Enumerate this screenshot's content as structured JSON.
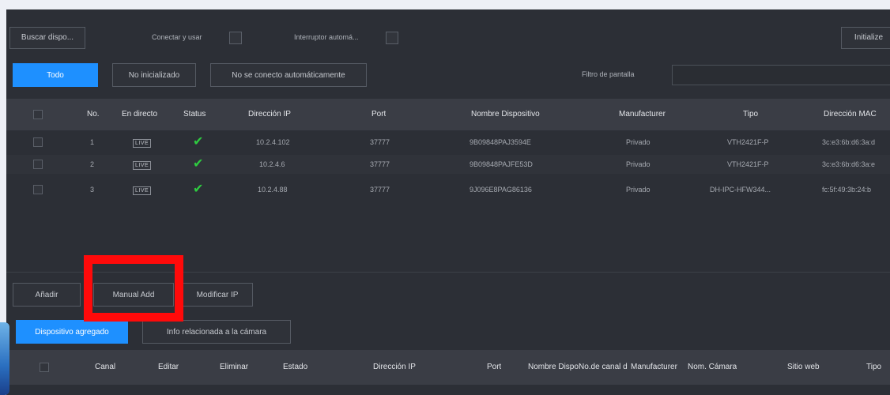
{
  "toolbar": {
    "search_label": "Buscar dispo...",
    "plug_label": "Conectar y usar",
    "auto_switch_label": "Interruptor automá...",
    "init_label": "Initialize"
  },
  "filters": {
    "tabs": [
      "Todo",
      "No inicializado",
      "No se conecto automáticamente"
    ],
    "screen_filter_label": "Filtro de pantalla",
    "screen_filter_value": ""
  },
  "devices_table": {
    "headers": [
      "No.",
      "En directo",
      "Status",
      "Dirección IP",
      "Port",
      "Nombre Dispositivo",
      "Manufacturer",
      "Tipo",
      "Dirección MAC"
    ],
    "rows": [
      {
        "no": "1",
        "live": "LIVE",
        "ip": "10.2.4.102",
        "port": "37777",
        "name": "9B09848PAJ3594E",
        "manufacturer": "Privado",
        "type": "VTH2421F-P",
        "mac": "3c:e3:6b:d6:3a:d"
      },
      {
        "no": "2",
        "live": "LIVE",
        "ip": "10.2.4.6",
        "port": "37777",
        "name": "9B09848PAJFE53D",
        "manufacturer": "Privado",
        "type": "VTH2421F-P",
        "mac": "3c:e3:6b:d6:3a:e"
      },
      {
        "no": "3",
        "live": "LIVE",
        "ip": "10.2.4.88",
        "port": "37777",
        "name": "9J096E8PAG86136",
        "manufacturer": "Privado",
        "type": "DH-IPC-HFW344...",
        "mac": "fc:5f:49:3b:24:b"
      }
    ]
  },
  "actions": {
    "add": "Añadir",
    "manual_add": "Manual Add",
    "modify_ip": "Modificar IP"
  },
  "bottom_tabs": [
    "Dispositivo agregado",
    "Info relacionada a la cámara"
  ],
  "added_table": {
    "headers": [
      "Canal",
      "Editar",
      "Eliminar",
      "Estado",
      "Dirección IP",
      "Port",
      "Nombre Dispo",
      "No.de canal d",
      "Manufacturer",
      "Nom. Cámara",
      "Sitio web",
      "Tipo"
    ]
  },
  "colors": {
    "accent": "#1e90ff",
    "highlight": "#ff0a0a",
    "status_ok": "#2ecc40"
  },
  "icons": {
    "status_ok": "check-icon"
  }
}
